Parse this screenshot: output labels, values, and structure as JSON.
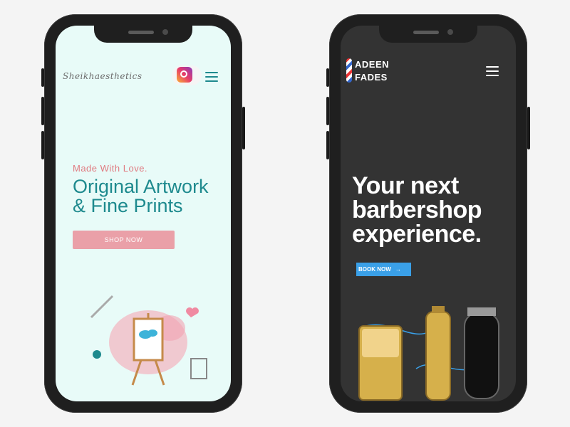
{
  "left_phone": {
    "logo_text": "Sheikhaesthetics",
    "headline_kicker": "Made With Love.",
    "headline_line1": "Original Artwork",
    "headline_line2": "& Fine Prints",
    "cta_label": "SHOP NOW",
    "colors": {
      "bg": "#e8fbf8",
      "teal": "#1e8a8e",
      "pink": "#eaa0a8"
    }
  },
  "right_phone": {
    "brand_line1": "ADEEN",
    "brand_line2": "FADES",
    "headline_line1": "Your next",
    "headline_line2": "barbershop",
    "headline_line3": "experience.",
    "cta_label": "BOOK NOW",
    "cta_icon": "arrow-right-icon",
    "colors": {
      "bg": "#333333",
      "cta": "#3aa0e8",
      "gold": "#d9b24a"
    }
  }
}
